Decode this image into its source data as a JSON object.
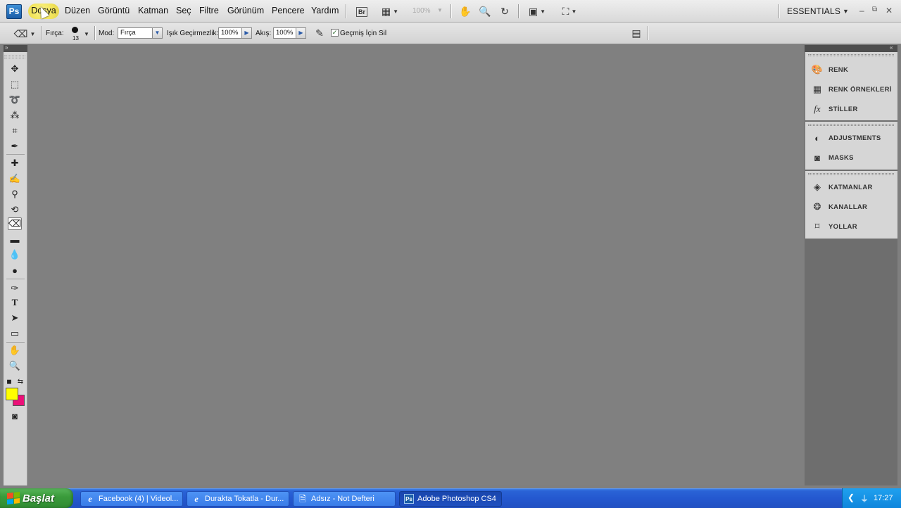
{
  "menubar": {
    "logo": "Ps",
    "items": [
      "Dosya",
      "Düzen",
      "Görüntü",
      "Katman",
      "Seç",
      "Filtre",
      "Görünüm",
      "Pencere",
      "Yardım"
    ],
    "bridge_label": "Br",
    "zoom": "100%",
    "workspace": "ESSENTIALS",
    "window_buttons": [
      "–",
      "⧉",
      "✕"
    ]
  },
  "options": {
    "brush_label": "Fırça:",
    "brush_size": "13",
    "mode_label": "Mod:",
    "mode_value": "Fırça",
    "opacity_label": "Işık Geçirmezlik:",
    "opacity_value": "100%",
    "flow_label": "Akış:",
    "flow_value": "100%",
    "erase_history_label": "Geçmiş İçin Sil",
    "erase_history_checked": true
  },
  "toolbox": {
    "tools": [
      "move",
      "marquee",
      "lasso",
      "quick-selection",
      "crop",
      "eyedropper",
      "healing-brush",
      "brush",
      "clone-stamp",
      "history-brush",
      "eraser",
      "gradient",
      "blur",
      "dodge",
      "pen",
      "type",
      "path-selection",
      "shape",
      "hand",
      "zoom"
    ],
    "active_tool": "eraser",
    "foreground_color": "#ffff00",
    "background_color": "#ec1078"
  },
  "dock": {
    "group1": [
      "RENK",
      "RENK ÖRNEKLERİ",
      "STİLLER"
    ],
    "group2": [
      "ADJUSTMENTS",
      "MASKS"
    ],
    "group3": [
      "KATMANLAR",
      "KANALLAR",
      "YOLLAR"
    ]
  },
  "taskbar": {
    "start_label": "Başlat",
    "tasks": [
      "Facebook (4) | Videol...",
      "Durakta Tokatla - Dur...",
      "Adsız - Not Defteri",
      "Adobe Photoshop CS4"
    ],
    "active_task": "Adobe Photoshop CS4",
    "clock": "17:27"
  }
}
